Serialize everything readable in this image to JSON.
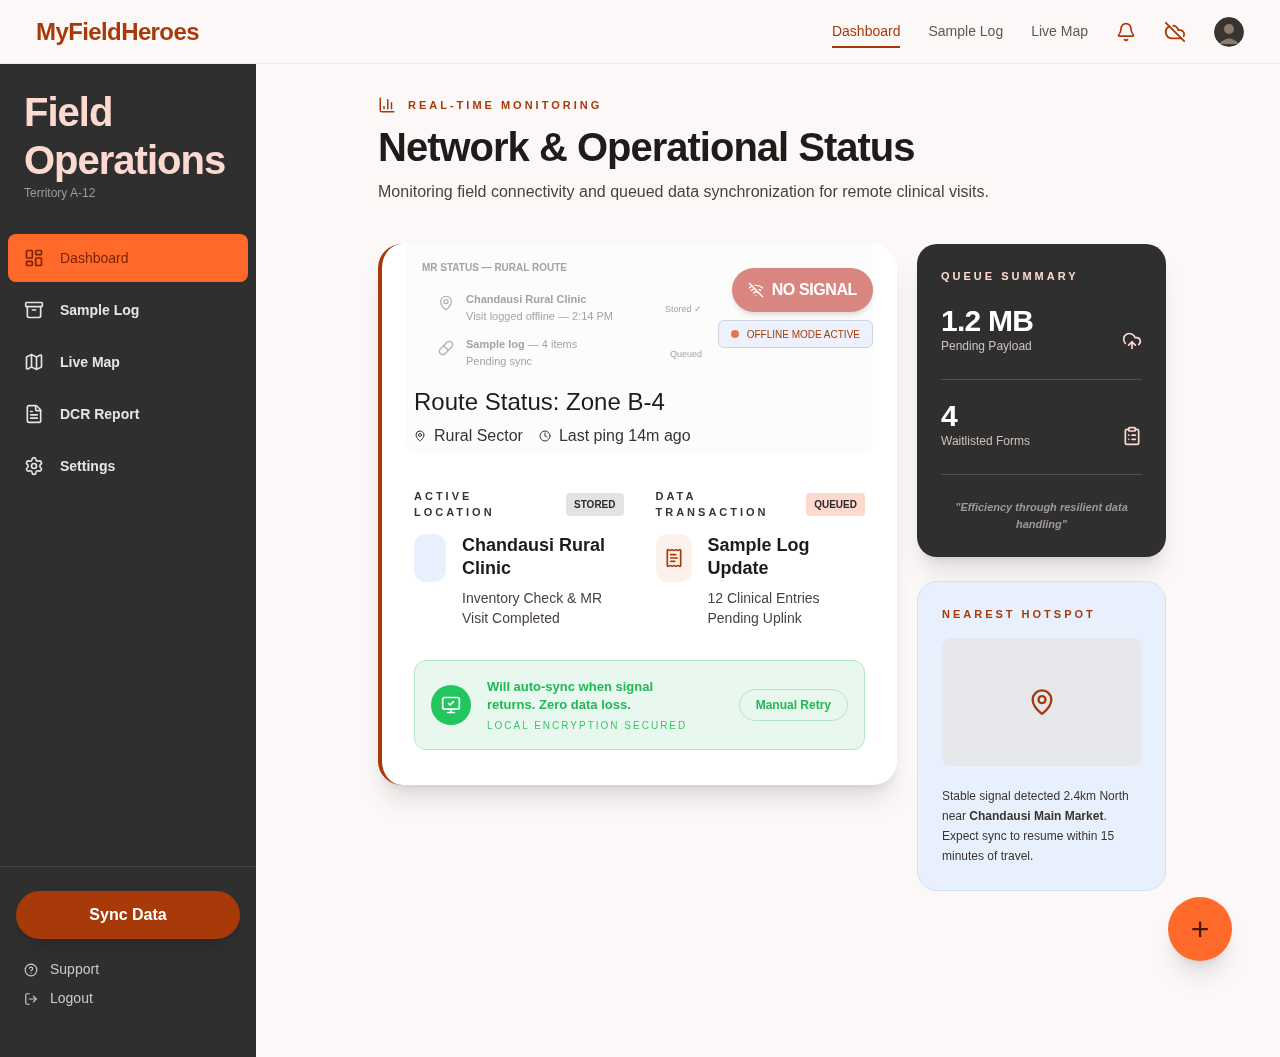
{
  "brand": "MyFieldHeroes",
  "top_nav": [
    {
      "label": "Dashboard",
      "selected": true
    },
    {
      "label": "Sample Log",
      "selected": false
    },
    {
      "label": "Live Map",
      "selected": false
    }
  ],
  "sidebar": {
    "title": "Field Operations",
    "subtitle": "Territory A-12",
    "items": [
      {
        "label": "Dashboard",
        "selected": true
      },
      {
        "label": "Sample Log",
        "selected": false
      },
      {
        "label": "Live Map",
        "selected": false
      },
      {
        "label": "DCR Report",
        "selected": false
      },
      {
        "label": "Settings",
        "selected": false
      }
    ],
    "sync_button": "Sync Data",
    "footer_links": [
      {
        "label": "Support"
      },
      {
        "label": "Logout"
      }
    ]
  },
  "header": {
    "eyebrow": "REAL-TIME MONITORING",
    "title": "Network & Operational Status",
    "subtitle": "Monitoring field connectivity and queued data synchronization for remote clinical visits."
  },
  "status_card": {
    "preview": {
      "heading": "MR STATUS — RURAL ROUTE",
      "rows": [
        {
          "title": "**Chandausi Rural Clinic**",
          "detail": "Visit logged offline — 2:14 PM",
          "status": "Stored ✓"
        },
        {
          "title": "**Sample log** — 4 items",
          "detail": "Pending sync",
          "status": "Queued"
        }
      ]
    },
    "signal_badge": "NO SIGNAL",
    "offline_badge": "OFFLINE MODE ACTIVE",
    "route_title": "Route Status: Zone B-4",
    "location": "Rural Sector",
    "last_ping": "Last ping 14m ago",
    "sections": [
      {
        "label": "ACTIVE LOCATION",
        "badge": "STORED",
        "kind": "stored",
        "title": "Chandausi Rural Clinic",
        "detail": "Inventory Check & MR Visit Completed"
      },
      {
        "label": "DATA TRANSACTION",
        "badge": "QUEUED",
        "kind": "queued",
        "title": "Sample Log Update",
        "detail": "12 Clinical Entries Pending Uplink"
      }
    ],
    "notice": {
      "message": "Will auto-sync when signal returns. Zero data loss.",
      "note": "LOCAL ENCRYPTION SECURED",
      "button": "Manual Retry"
    }
  },
  "queue_summary": {
    "title": "QUEUE SUMMARY",
    "stats": [
      {
        "value": "1.2 MB",
        "label": "Pending Payload"
      },
      {
        "value": "4",
        "label": "Waitlisted Forms"
      }
    ],
    "quote": "\"Efficiency through resilient data handling\""
  },
  "hotspot": {
    "title": "NEAREST HOTSPOT",
    "text": "Stable signal detected 2.4km North near **Chandausi Main Market**. Expect sync to resume within 15 minutes of travel."
  },
  "fab": "+"
}
